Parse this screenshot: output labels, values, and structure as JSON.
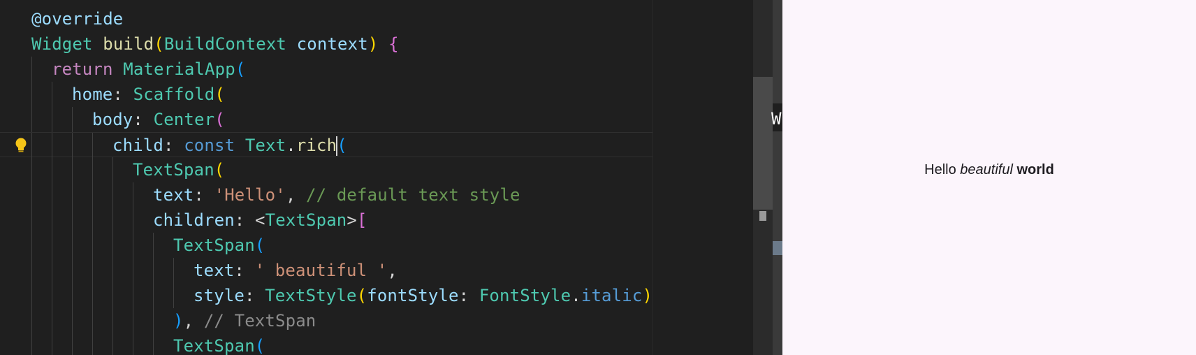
{
  "editor": {
    "lines": [
      {
        "indent": 0,
        "tokens": [
          {
            "t": "@override",
            "c": "t-param"
          }
        ]
      },
      {
        "indent": 0,
        "tokens": [
          {
            "t": "Widget",
            "c": "t-type"
          },
          {
            "t": " ",
            "c": "t-plain"
          },
          {
            "t": "build",
            "c": "t-fn"
          },
          {
            "t": "(",
            "c": "t-bracket"
          },
          {
            "t": "BuildContext",
            "c": "t-type"
          },
          {
            "t": " ",
            "c": "t-plain"
          },
          {
            "t": "context",
            "c": "t-param"
          },
          {
            "t": ")",
            "c": "t-bracket"
          },
          {
            "t": " ",
            "c": "t-plain"
          },
          {
            "t": "{",
            "c": "t-paren"
          }
        ]
      },
      {
        "indent": 1,
        "tokens": [
          {
            "t": "return",
            "c": "t-kw"
          },
          {
            "t": " ",
            "c": "t-plain"
          },
          {
            "t": "MaterialApp",
            "c": "t-type"
          },
          {
            "t": "(",
            "c": "t-blue"
          }
        ]
      },
      {
        "indent": 2,
        "tokens": [
          {
            "t": "home",
            "c": "t-param"
          },
          {
            "t": ": ",
            "c": "t-plain"
          },
          {
            "t": "Scaffold",
            "c": "t-type"
          },
          {
            "t": "(",
            "c": "t-bracket"
          }
        ]
      },
      {
        "indent": 3,
        "tokens": [
          {
            "t": "body",
            "c": "t-param"
          },
          {
            "t": ": ",
            "c": "t-plain"
          },
          {
            "t": "Center",
            "c": "t-type"
          },
          {
            "t": "(",
            "c": "t-paren"
          }
        ]
      },
      {
        "indent": 4,
        "current": true,
        "lightbulb": true,
        "tokens": [
          {
            "t": "child",
            "c": "t-param"
          },
          {
            "t": ": ",
            "c": "t-plain"
          },
          {
            "t": "const",
            "c": "t-const"
          },
          {
            "t": " ",
            "c": "t-plain"
          },
          {
            "t": "Text",
            "c": "t-type"
          },
          {
            "t": ".",
            "c": "t-plain"
          },
          {
            "t": "rich",
            "c": "t-fn"
          },
          {
            "t": "(",
            "c": "t-blue",
            "cursor": true
          }
        ]
      },
      {
        "indent": 5,
        "tokens": [
          {
            "t": "TextSpan",
            "c": "t-type"
          },
          {
            "t": "(",
            "c": "t-bracket"
          }
        ]
      },
      {
        "indent": 6,
        "tokens": [
          {
            "t": "text",
            "c": "t-param"
          },
          {
            "t": ": ",
            "c": "t-plain"
          },
          {
            "t": "'Hello'",
            "c": "t-str"
          },
          {
            "t": ", ",
            "c": "t-plain"
          },
          {
            "t": "// default text style",
            "c": "t-cmt"
          }
        ]
      },
      {
        "indent": 6,
        "tokens": [
          {
            "t": "children",
            "c": "t-param"
          },
          {
            "t": ": <",
            "c": "t-plain"
          },
          {
            "t": "TextSpan",
            "c": "t-type"
          },
          {
            "t": ">",
            "c": "t-plain"
          },
          {
            "t": "[",
            "c": "t-paren"
          }
        ]
      },
      {
        "indent": 7,
        "tokens": [
          {
            "t": "TextSpan",
            "c": "t-type"
          },
          {
            "t": "(",
            "c": "t-blue"
          }
        ]
      },
      {
        "indent": 8,
        "tokens": [
          {
            "t": "text",
            "c": "t-param"
          },
          {
            "t": ": ",
            "c": "t-plain"
          },
          {
            "t": "' beautiful '",
            "c": "t-str"
          },
          {
            "t": ",",
            "c": "t-plain"
          }
        ]
      },
      {
        "indent": 8,
        "tokens": [
          {
            "t": "style",
            "c": "t-param"
          },
          {
            "t": ": ",
            "c": "t-plain"
          },
          {
            "t": "TextStyle",
            "c": "t-type"
          },
          {
            "t": "(",
            "c": "t-bracket"
          },
          {
            "t": "fontStyle",
            "c": "t-param"
          },
          {
            "t": ": ",
            "c": "t-plain"
          },
          {
            "t": "FontStyle",
            "c": "t-type"
          },
          {
            "t": ".",
            "c": "t-plain"
          },
          {
            "t": "italic",
            "c": "t-const"
          },
          {
            "t": ")",
            "c": "t-bracket"
          },
          {
            "t": ",",
            "c": "t-plain"
          }
        ]
      },
      {
        "indent": 7,
        "tokens": [
          {
            "t": ")",
            "c": "t-blue"
          },
          {
            "t": ", ",
            "c": "t-plain"
          },
          {
            "t": "// TextSpan",
            "c": "t-muted"
          }
        ]
      },
      {
        "indent": 7,
        "tokens": [
          {
            "t": "TextSpan",
            "c": "t-type"
          },
          {
            "t": "(",
            "c": "t-blue"
          }
        ]
      }
    ]
  },
  "side_panel": {
    "clipped_glyph": "W"
  },
  "preview": {
    "plain": "Hello",
    "italic": "beautiful",
    "bold": "world"
  },
  "colors": {
    "editor_bg": "#1f1f1f",
    "preview_bg": "#fcf5fc",
    "lightbulb": "#f5c518"
  }
}
